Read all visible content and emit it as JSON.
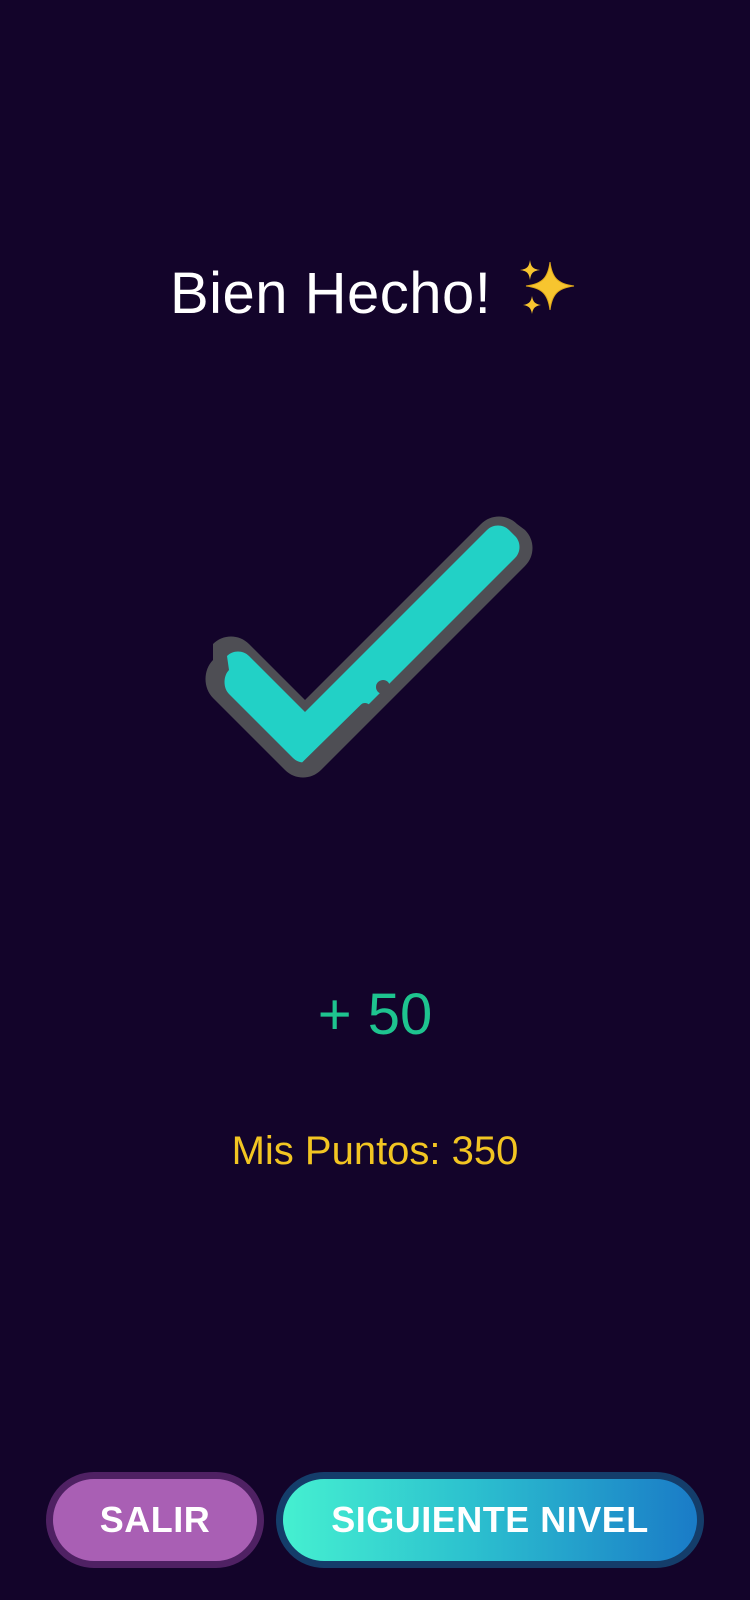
{
  "result": {
    "title": "Bien Hecho!",
    "title_icon": "sparkles-icon",
    "status_icon": "checkmark-icon",
    "points_gained": "+ 50",
    "my_points": "Mis Puntos: 350"
  },
  "actions": {
    "exit_label": "SALIR",
    "next_label": "SIGUIENTE NIVEL"
  },
  "colors": {
    "background": "#13042a",
    "check_fill": "#22d1c6",
    "check_outline": "#4e4e54",
    "points_gain": "#1ec48f",
    "my_points": "#f2c522",
    "exit_button": "#a95fb4",
    "next_button_start": "#45f0d0",
    "next_button_end": "#1a7bc7"
  }
}
